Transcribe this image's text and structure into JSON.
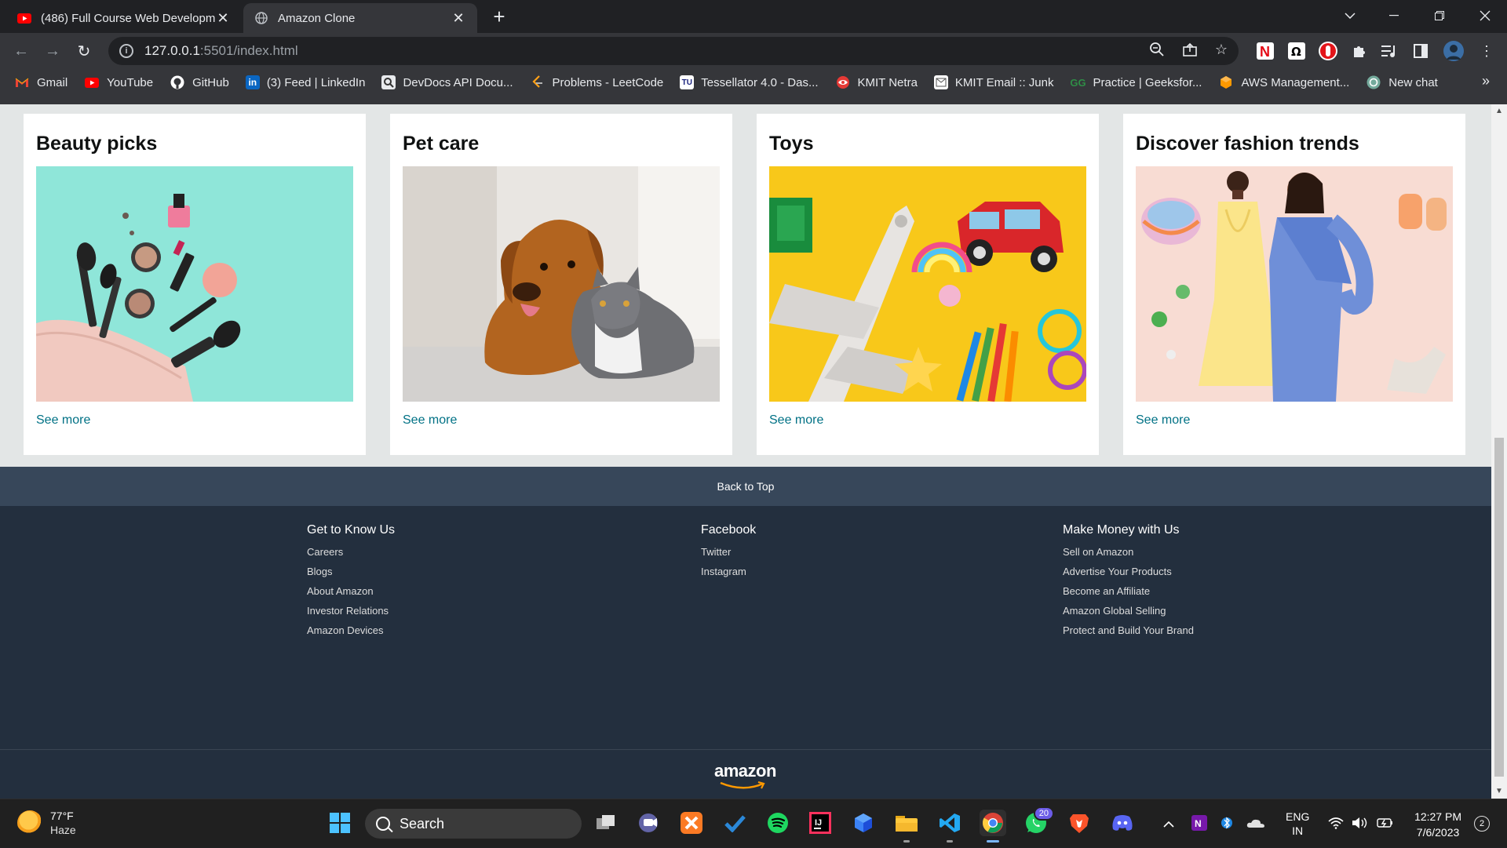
{
  "browser": {
    "tabs": [
      {
        "title": "(486) Full Course Web Developm",
        "icon": "youtube-icon",
        "active": false
      },
      {
        "title": "Amazon Clone",
        "icon": "globe-icon",
        "active": true
      }
    ],
    "url_host": "127.0.0.1",
    "url_path": ":5501/index.html",
    "bookmarks": [
      {
        "label": "Gmail",
        "icon": "gmail-icon",
        "color": "#ea4335"
      },
      {
        "label": "YouTube",
        "icon": "youtube-icon",
        "color": "#ff0000"
      },
      {
        "label": "GitHub",
        "icon": "github-icon",
        "color": "#ffffff"
      },
      {
        "label": "(3) Feed | LinkedIn",
        "icon": "linkedin-icon",
        "color": "#0a66c2"
      },
      {
        "label": "DevDocs API Docu...",
        "icon": "devdocs-icon",
        "color": "#cccccc"
      },
      {
        "label": "Problems - LeetCode",
        "icon": "leetcode-icon",
        "color": "#ffa116"
      },
      {
        "label": "Tessellator 4.0 - Das...",
        "icon": "tessellator-icon",
        "color": "#ffffff"
      },
      {
        "label": "KMIT Netra",
        "icon": "netra-icon",
        "color": "#e53935"
      },
      {
        "label": "KMIT Email :: Junk",
        "icon": "email-icon",
        "color": "#ffffff"
      },
      {
        "label": "Practice | Geeksfor...",
        "icon": "geeksforgeeks-icon",
        "color": "#2f8d46"
      },
      {
        "label": "AWS Management...",
        "icon": "aws-icon",
        "color": "#ff9900"
      },
      {
        "label": "New chat",
        "icon": "chatgpt-icon",
        "color": "#74aa9c"
      }
    ]
  },
  "page": {
    "cards": [
      {
        "title": "Beauty picks",
        "link": "See more",
        "image": "beauty-products-image"
      },
      {
        "title": "Pet care",
        "link": "See more",
        "image": "dog-and-cat-image"
      },
      {
        "title": "Toys",
        "link": "See more",
        "image": "toys-image"
      },
      {
        "title": "Discover fashion trends",
        "link": "See more",
        "image": "fashion-models-image"
      }
    ],
    "footer": {
      "back_to_top": "Back to Top",
      "columns": [
        {
          "heading": "Get to Know Us",
          "links": [
            "Careers",
            "Blogs",
            "About Amazon",
            "Investor Relations",
            "Amazon Devices"
          ]
        },
        {
          "heading": "Facebook",
          "links": [
            "Twitter",
            "Instagram"
          ]
        },
        {
          "heading": "Make Money with Us",
          "links": [
            "Sell on Amazon",
            "Advertise Your Products",
            "Become an Affiliate",
            "Amazon Global Selling",
            "Protect and Build Your Brand"
          ]
        }
      ],
      "logo": "amazon"
    }
  },
  "taskbar": {
    "weather_temp": "77°F",
    "weather_condition": "Haze",
    "search_label": "Search",
    "whatsapp_badge": "20",
    "language": "ENG",
    "region": "IN",
    "time": "12:27 PM",
    "date": "7/6/2023",
    "notifications": "2"
  }
}
